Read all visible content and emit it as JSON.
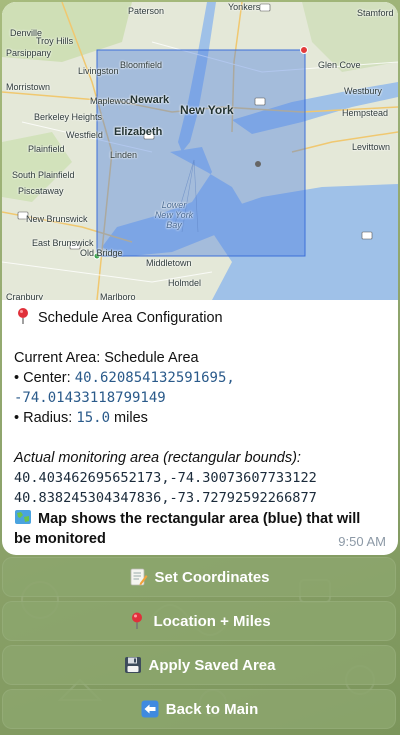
{
  "map": {
    "labels": {
      "paterson": "Paterson",
      "yonkers": "Yonkers",
      "stamford": "Stamford",
      "denville": "Denville",
      "troy_hills": "Troy Hills",
      "parsippany": "Parsippany",
      "livingston": "Livingston",
      "bloomfield": "Bloomfield",
      "morristown": "Morristown",
      "maplewood": "Maplewood",
      "newark": "Newark",
      "berkeley_heights": "Berkeley Heights",
      "westfield": "Westfield",
      "elizabeth": "Elizabeth",
      "linden": "Linden",
      "plainfield": "Plainfield",
      "south_plainfield": "South Plainfield",
      "piscataway": "Piscataway",
      "new_brunswick": "New Brunswick",
      "east_brunswick": "East Brunswick",
      "old_bridge": "Old Bridge",
      "cranbury": "Cranbury",
      "marlboro": "Marlboro",
      "new_york": "New York",
      "lower_bay": "Lower New York Bay",
      "middletown": "Middletown",
      "holmdel": "Holmdel",
      "hempstead": "Hempstead",
      "westbury": "Westbury",
      "levittown": "Levittown",
      "glen_cove": "Glen Cove"
    },
    "bounds_fill": "#4d7fe0",
    "marker_color": "#e23b3b"
  },
  "message": {
    "title_icon": "round-pushpin-icon",
    "title": "Schedule Area Configuration",
    "current_area": "Current Area: Schedule Area",
    "center_label": "• Center: ",
    "center_lat": "40.620854132591695,",
    "center_lon": "-74.01433118799149",
    "radius_label": "• Radius: ",
    "radius_value": "15.0",
    "radius_unit": " miles",
    "bounds_heading": "Actual monitoring area (rectangular bounds):",
    "bounds_sw": "40.403462695652173,-74.30073607733122",
    "bounds_ne": "40.838245304347836,-73.72792592266877",
    "map_note_line1": "Map shows the rectangular area (blue) that will",
    "map_note_line2": "be monitored",
    "time": "9:50 AM"
  },
  "keyboard": [
    {
      "icon": "memo-icon",
      "label": "Set Coordinates"
    },
    {
      "icon": "round-pushpin-icon",
      "label": "Location + Miles"
    },
    {
      "icon": "floppy-disk-icon",
      "label": "Apply Saved Area"
    },
    {
      "icon": "back-arrow-icon",
      "label": "Back to Main"
    }
  ]
}
